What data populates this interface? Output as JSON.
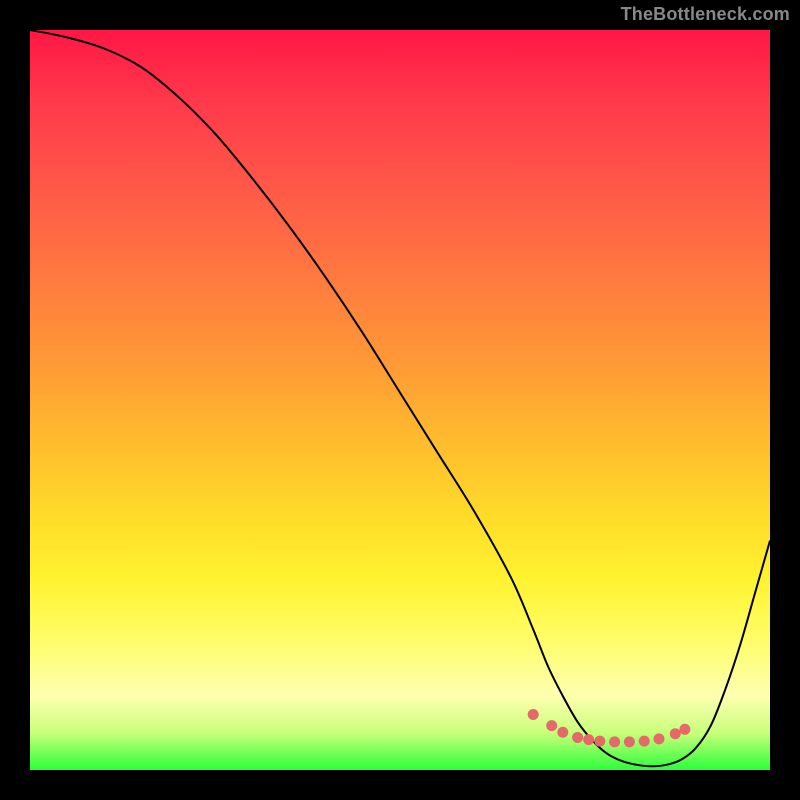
{
  "watermark": "TheBottleneck.com",
  "colors": {
    "marker": "#e46a6a",
    "curve": "#000000",
    "frame": "#000000"
  },
  "chart_data": {
    "type": "line",
    "title": "",
    "xlabel": "",
    "ylabel": "",
    "xlim": [
      0,
      100
    ],
    "ylim": [
      0,
      100
    ],
    "grid": false,
    "legend": false,
    "series": [
      {
        "name": "bottleneck-curve",
        "x": [
          0,
          5,
          10,
          15,
          20,
          25,
          30,
          35,
          40,
          45,
          50,
          55,
          60,
          65,
          68,
          70,
          72,
          74,
          76,
          78,
          80,
          82,
          84,
          86,
          88,
          90,
          92,
          94,
          96,
          98,
          100
        ],
        "values": [
          100,
          99,
          97.5,
          95,
          91,
          86,
          80,
          73.5,
          66.5,
          59,
          51,
          43,
          35,
          26,
          19,
          14,
          10,
          6.5,
          4,
          2.2,
          1.2,
          0.7,
          0.5,
          0.7,
          1.4,
          3,
          6,
          11,
          17,
          24,
          31
        ]
      }
    ],
    "markers": {
      "name": "optimum-points",
      "color": "#e46a6a",
      "x": [
        68,
        70.5,
        72,
        74,
        75.5,
        77,
        79,
        81,
        83,
        85,
        87.2,
        88.5
      ],
      "values": [
        7.5,
        6.0,
        5.1,
        4.4,
        4.1,
        3.9,
        3.8,
        3.8,
        3.9,
        4.2,
        4.9,
        5.5
      ]
    }
  }
}
